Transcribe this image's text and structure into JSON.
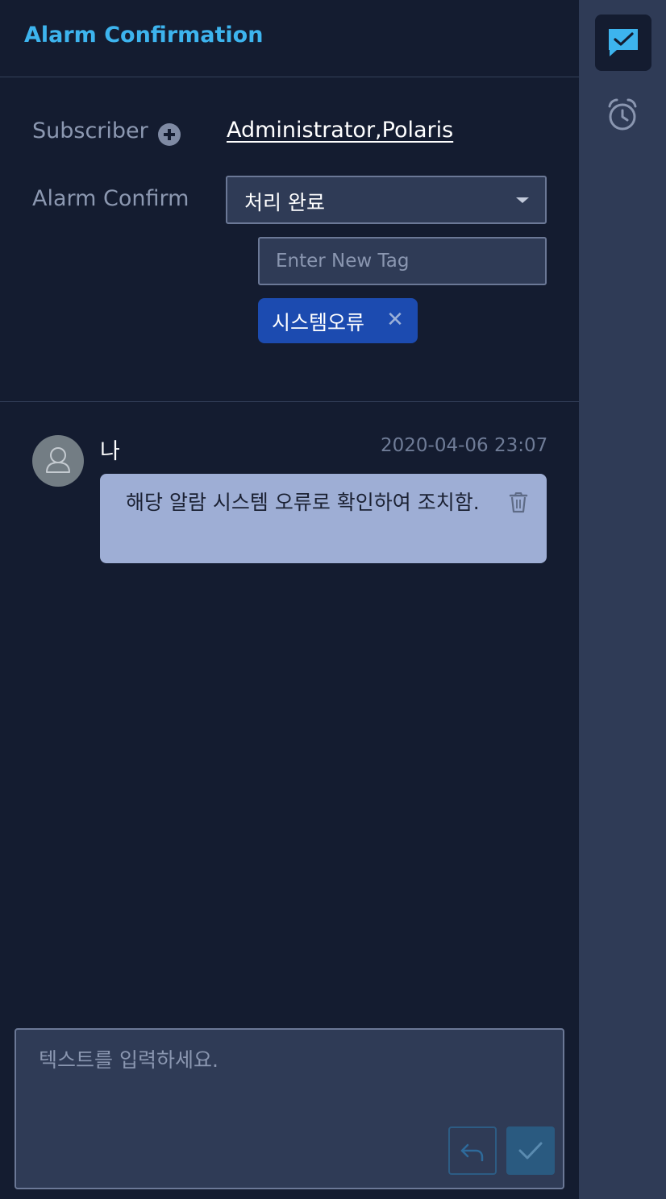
{
  "header": {
    "title": "Alarm Confirmation"
  },
  "form": {
    "subscriber_label": "Subscriber",
    "subscriber_value": "Administrator,Polaris",
    "alarm_confirm_label": "Alarm Confirm",
    "alarm_confirm_value": "처리 완료",
    "tag_placeholder": "Enter New Tag",
    "tags": [
      "시스템오류"
    ]
  },
  "comments": [
    {
      "author": "나",
      "timestamp": "2020-04-06 23:07",
      "text": "해당 알람 시스템 오류로 확인하여 조치함."
    }
  ],
  "composer": {
    "placeholder": "텍스트를 입력하세요."
  },
  "sidebar": {
    "items": [
      "chat-check-icon",
      "alarm-clock-icon"
    ]
  },
  "colors": {
    "accent": "#3db4ee",
    "background": "#141c30",
    "panel": "#2f3b56",
    "tag": "#1c4bb0",
    "bubble": "#9eaed5"
  }
}
